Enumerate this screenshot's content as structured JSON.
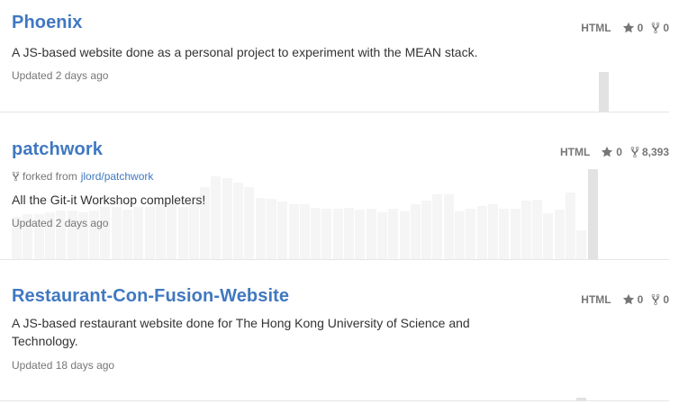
{
  "repos": [
    {
      "name": "Phoenix",
      "language": "HTML",
      "stars": "0",
      "forks": "0",
      "description": "A JS-based website done as a personal project to experiment with the MEAN stack.",
      "updated": "Updated 2 days ago",
      "activity": [
        0,
        0,
        0,
        0,
        0,
        0,
        0,
        0,
        0,
        0,
        0,
        0,
        0,
        0,
        0,
        0,
        0,
        0,
        0,
        0,
        0,
        0,
        0,
        0,
        0,
        0,
        0,
        0,
        0,
        0,
        0,
        0,
        0,
        0,
        0,
        0,
        0,
        0,
        0,
        0,
        0,
        0,
        0,
        0,
        0,
        0,
        0,
        0,
        0,
        0,
        0,
        0,
        0,
        0.4
      ]
    },
    {
      "name": "patchwork",
      "language": "HTML",
      "stars": "0",
      "forks": "8,393",
      "forked_from_label": "forked from",
      "forked_from": "jlord/patchwork",
      "description": "All the Git-it Workshop completers!",
      "updated": "Updated 2 days ago",
      "activity": [
        0.43,
        0.45,
        0.45,
        0.47,
        0.49,
        0.49,
        0.47,
        0.49,
        0.53,
        0.53,
        0.5,
        0.53,
        0.53,
        0.56,
        0.55,
        0.53,
        0.58,
        0.73,
        0.84,
        0.82,
        0.77,
        0.73,
        0.62,
        0.61,
        0.58,
        0.55,
        0.55,
        0.52,
        0.51,
        0.51,
        0.52,
        0.5,
        0.51,
        0.47,
        0.51,
        0.48,
        0.55,
        0.59,
        0.65,
        0.65,
        0.48,
        0.51,
        0.54,
        0.55,
        0.51,
        0.51,
        0.59,
        0.6,
        0.46,
        0.5,
        0.67,
        0.29,
        0.91
      ]
    },
    {
      "name": "Restaurant-Con-Fusion-Website",
      "language": "HTML",
      "stars": "0",
      "forks": "0",
      "description": "A JS-based restaurant website done for The Hong Kong University of Science and Technology.",
      "updated": "Updated 18 days ago",
      "activity": [
        0,
        0,
        0,
        0,
        0,
        0,
        0,
        0,
        0,
        0,
        0,
        0,
        0,
        0,
        0,
        0,
        0,
        0,
        0,
        0,
        0,
        0,
        0,
        0,
        0,
        0,
        0,
        0,
        0,
        0,
        0,
        0,
        0,
        0,
        0,
        0,
        0,
        0,
        0,
        0,
        0,
        0,
        0,
        0,
        0,
        0,
        0,
        0,
        0,
        0,
        0,
        0.03
      ]
    }
  ],
  "colors": {
    "link": "#4078c0",
    "muted": "#767676",
    "text": "#333333",
    "spark_light": "#f5f5f5",
    "spark_dark": "#e2e2e2"
  }
}
